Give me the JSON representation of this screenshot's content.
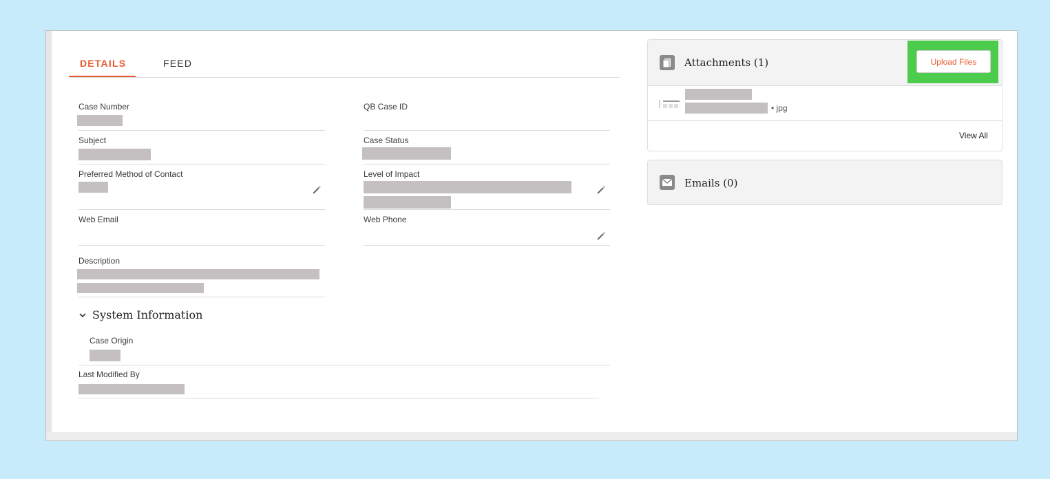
{
  "tabs": {
    "details": "DETAILS",
    "feed": "FEED"
  },
  "fields": {
    "case_number": "Case Number",
    "qb_case_id": "QB Case ID",
    "subject": "Subject",
    "case_status": "Case Status",
    "preferred_contact": "Preferred Method of Contact",
    "level_of_impact": "Level of Impact",
    "web_email": "Web Email",
    "web_phone": "Web Phone",
    "description": "Description"
  },
  "system_info": {
    "title": "System Information",
    "case_origin": "Case Origin",
    "last_modified_by": "Last Modified By"
  },
  "attachments": {
    "title": "Attachments (1)",
    "upload_label": "Upload Files",
    "file_ext": "• jpg",
    "view_all": "View All"
  },
  "emails": {
    "title": "Emails (0)"
  },
  "colors": {
    "accent": "#e8582c",
    "highlight": "#4ccc4c",
    "background": "#c8ebfb"
  },
  "icons": [
    "pencil-icon",
    "chevron-down-icon",
    "file-icon",
    "email-icon"
  ]
}
